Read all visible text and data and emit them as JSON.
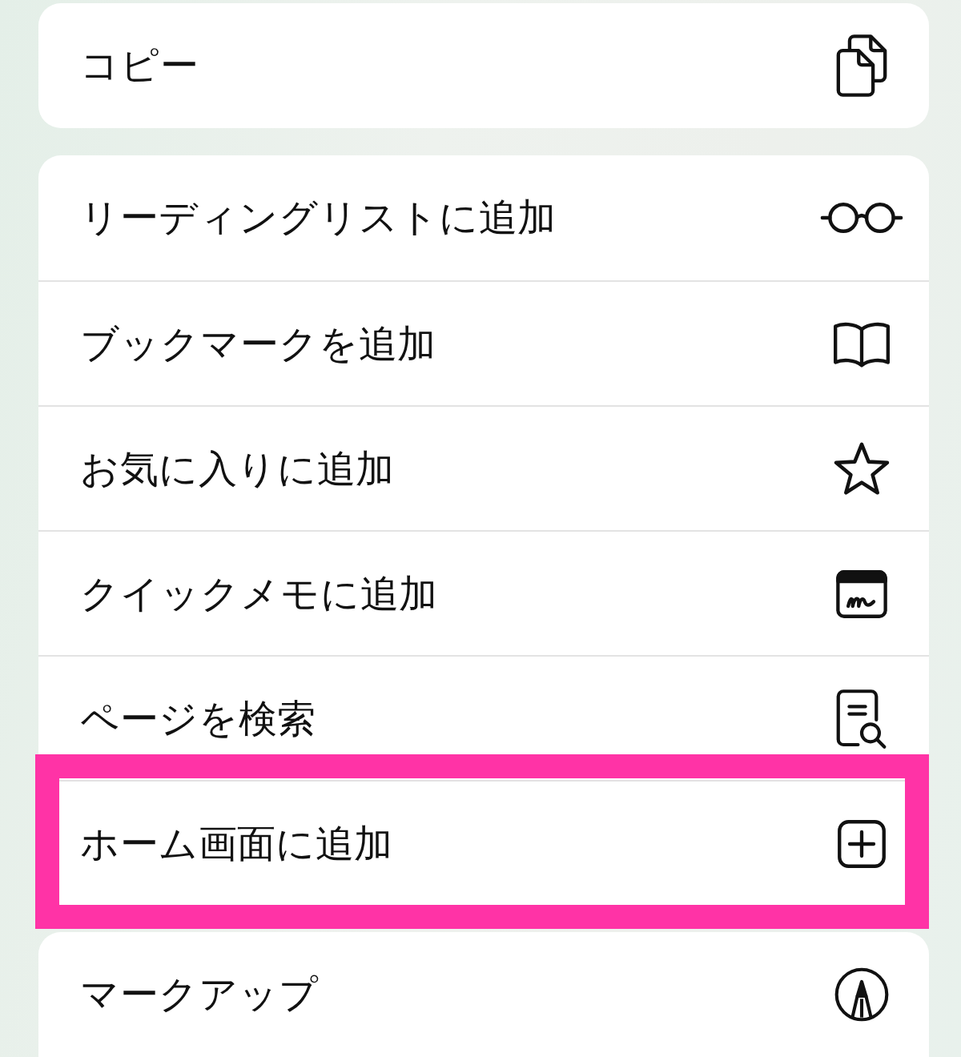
{
  "groups": [
    {
      "items": [
        {
          "label": "コピー",
          "kind": "copy",
          "highlighted": false
        }
      ]
    },
    {
      "items": [
        {
          "label": "リーディングリストに追加",
          "kind": "reading-list",
          "highlighted": false
        },
        {
          "label": "ブックマークを追加",
          "kind": "bookmark",
          "highlighted": false
        },
        {
          "label": "お気に入りに追加",
          "kind": "favorite",
          "highlighted": false
        },
        {
          "label": "クイックメモに追加",
          "kind": "quick-note",
          "highlighted": false
        },
        {
          "label": "ページを検索",
          "kind": "find",
          "highlighted": false
        },
        {
          "label": "ホーム画面に追加",
          "kind": "home-screen",
          "highlighted": true
        }
      ]
    },
    {
      "items": [
        {
          "label": "マークアップ",
          "kind": "markup",
          "highlighted": false
        }
      ]
    }
  ]
}
